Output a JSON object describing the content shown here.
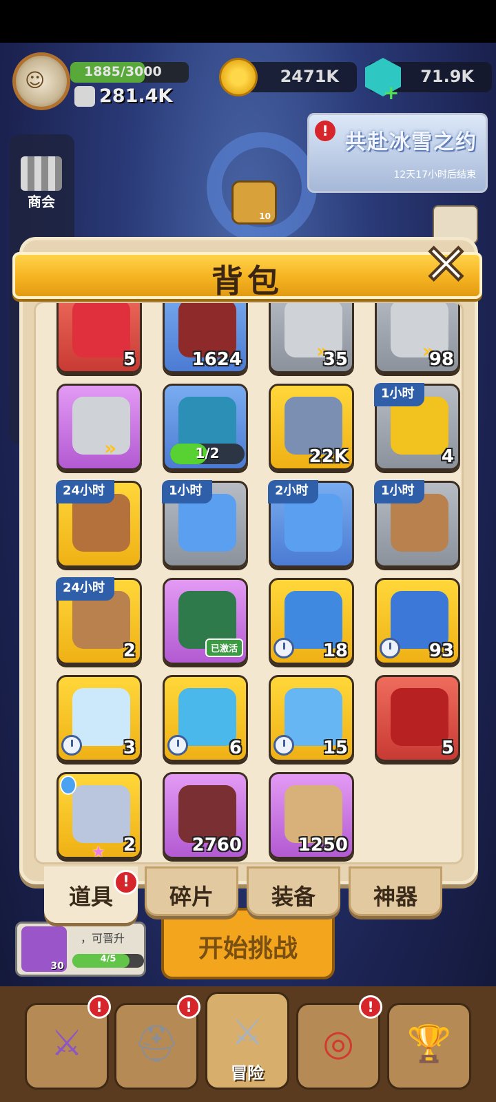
{
  "hud": {
    "xp_text": "1885/3000",
    "xp_fraction": 0.628,
    "power": "281.4K",
    "gold": "2471K",
    "gems": "71.9K"
  },
  "side": {
    "shop_label": "商会",
    "scroll_count": "10"
  },
  "event": {
    "title": "共赴冰雪之约",
    "timer": "12天17小时后结束"
  },
  "modal": {
    "title": "背包",
    "close_icon": "close-x-icon"
  },
  "items": [
    {
      "icon": "red-crystal-icon",
      "count": "5"
    },
    {
      "icon": "red-book-icon",
      "count": "1624"
    },
    {
      "icon": "hammer-fast-icon",
      "count": "35"
    },
    {
      "icon": "hammer-fast-icon",
      "count": "98"
    },
    {
      "icon": "hammer-fast-icon",
      "count": ""
    },
    {
      "icon": "blue-card-icon",
      "progress_text": "1/2",
      "progress_fraction": 0.5
    },
    {
      "icon": "triangle-medal-icon",
      "count": "22K"
    },
    {
      "icon": "gold-coin-icon",
      "timer": "1小时",
      "count": "4"
    },
    {
      "icon": "treasure-chest-icon",
      "timer": "24小时"
    },
    {
      "icon": "blue-swirl-icon",
      "timer": "1小时"
    },
    {
      "icon": "blue-swirl-icon",
      "timer": "2小时"
    },
    {
      "icon": "wood-log-icon",
      "timer": "1小时"
    },
    {
      "icon": "wood-log-icon",
      "timer": "24小时",
      "count": "2"
    },
    {
      "icon": "green-frame-icon",
      "active_text": "已激活"
    },
    {
      "icon": "snow-ticket-icon",
      "count": "18"
    },
    {
      "icon": "snow-letter-icon",
      "count": "93"
    },
    {
      "icon": "tile-reset-icon",
      "count": "3"
    },
    {
      "icon": "refresh-arrow-icon",
      "count": "6"
    },
    {
      "icon": "alarm-clock-icon",
      "count": "15"
    },
    {
      "icon": "red-chest-card-icon",
      "count": "5"
    },
    {
      "icon": "silver-helmet-icon",
      "count": "2"
    },
    {
      "icon": "dark-ore-icon",
      "count": "2760"
    },
    {
      "icon": "purple-scroll-icon",
      "count": "1250"
    }
  ],
  "tabs": [
    {
      "label": "道具",
      "badge": "!"
    },
    {
      "label": "碎片"
    },
    {
      "label": "装备"
    },
    {
      "label": "神器"
    }
  ],
  "behind": {
    "hero_level": "30",
    "hero_text": "，可晋升",
    "hero_progress": "4/5",
    "hero_progress_fraction": 0.8,
    "start_label": "开始挑战"
  },
  "nav": [
    {
      "icon": "sword-banner-icon",
      "label": "",
      "badge": "!"
    },
    {
      "icon": "viking-helmet-icon",
      "label": "",
      "badge": "!"
    },
    {
      "icon": "crossed-swords-icon",
      "label": "冒险"
    },
    {
      "icon": "target-icon",
      "label": "",
      "badge": "!"
    },
    {
      "icon": "trophy-icon",
      "label": ""
    }
  ]
}
